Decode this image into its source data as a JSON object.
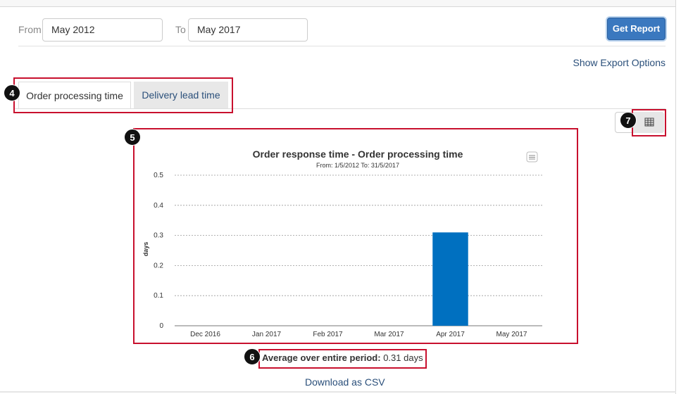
{
  "filters": {
    "from_label": "From",
    "from_value": "May 2012",
    "to_label": "To",
    "to_value": "May 2017",
    "get_report_label": "Get Report"
  },
  "export": {
    "show_export_label": "Show Export Options"
  },
  "tabs": [
    {
      "label": "Order processing time",
      "active": true
    },
    {
      "label": "Delivery lead time",
      "active": false
    }
  ],
  "annotations": {
    "tabs_badge": "4",
    "chart_badge": "5",
    "average_badge": "6",
    "view_toggle_badge": "7"
  },
  "colors": {
    "accent": "#3a78bf",
    "bar": "#0070c0",
    "highlight": "#c8102e",
    "link": "#2a4f7a"
  },
  "chart_data": {
    "type": "bar",
    "title": "Order response time - Order processing time",
    "subtitle": "From: 1/5/2012 To: 31/5/2017",
    "xlabel": "",
    "ylabel": "days",
    "categories": [
      "Dec 2016",
      "Jan 2017",
      "Feb 2017",
      "Mar 2017",
      "Apr 2017",
      "May 2017"
    ],
    "values": [
      0,
      0,
      0,
      0,
      0.31,
      0
    ],
    "ylim": [
      0,
      0.5
    ],
    "yticks": [
      "0",
      "0.1",
      "0.2",
      "0.3",
      "0.4",
      "0.5"
    ],
    "grid": true,
    "legend": "none"
  },
  "summary": {
    "average_label": "Average over entire period:",
    "average_value": "0.31 days"
  },
  "download": {
    "csv_label": "Download as CSV"
  },
  "icons": {
    "view_table": "table-icon",
    "chart_menu": "menu-icon"
  }
}
